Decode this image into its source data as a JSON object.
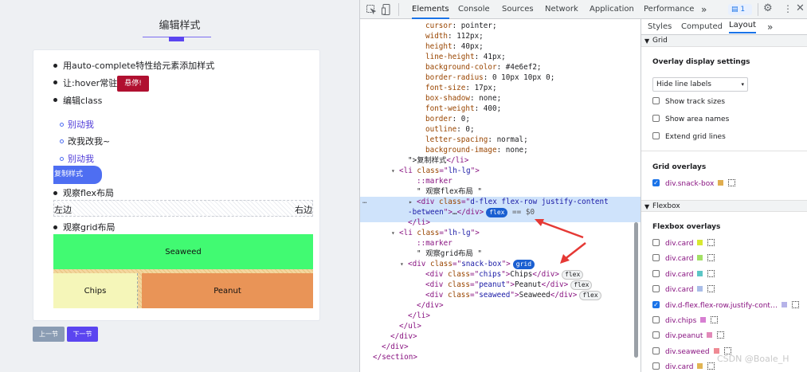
{
  "page": {
    "title": "编辑样式"
  },
  "list": [
    {
      "text": "用auto-complete特性给元素添加样式"
    },
    {
      "text": "让:hover常驻",
      "button": "悬停!"
    },
    {
      "text": "编辑class",
      "sub": [
        "别动我",
        "改我改我~",
        "别动我"
      ],
      "button": "复制样式"
    },
    {
      "text": "观察flex布局",
      "left": "左边",
      "right": "右边"
    },
    {
      "text": "观察grid布局",
      "cells": {
        "seaweed": "Seaweed",
        "chips": "Chips",
        "peanut": "Peanut"
      }
    }
  ],
  "pager": {
    "prev": "上一节",
    "next": "下一节"
  },
  "devtools": {
    "tabs": [
      "Elements",
      "Console",
      "Sources",
      "Network",
      "Application",
      "Performance"
    ],
    "more": "»",
    "issues": "1",
    "code": [
      {
        "i": 8,
        "p": [
          [
            "at",
            "cursor"
          ],
          [
            "tx",
            ": pointer;"
          ]
        ]
      },
      {
        "i": 8,
        "p": [
          [
            "at",
            "width"
          ],
          [
            "tx",
            ": 112px;"
          ]
        ]
      },
      {
        "i": 8,
        "p": [
          [
            "at",
            "height"
          ],
          [
            "tx",
            ": 40px;"
          ]
        ]
      },
      {
        "i": 8,
        "p": [
          [
            "at",
            "line-height"
          ],
          [
            "tx",
            ": 41px;"
          ]
        ]
      },
      {
        "i": 8,
        "p": [
          [
            "at",
            "background-color"
          ],
          [
            "tx",
            ": #4e6ef2;"
          ]
        ]
      },
      {
        "i": 8,
        "p": [
          [
            "at",
            "border-radius"
          ],
          [
            "tx",
            ": 0 10px 10px 0;"
          ]
        ]
      },
      {
        "i": 8,
        "p": [
          [
            "at",
            "font-size"
          ],
          [
            "tx",
            ": 17px;"
          ]
        ]
      },
      {
        "i": 8,
        "p": [
          [
            "at",
            "box-shadow"
          ],
          [
            "tx",
            ": none;"
          ]
        ]
      },
      {
        "i": 8,
        "p": [
          [
            "at",
            "font-weight"
          ],
          [
            "tx",
            ": 400;"
          ]
        ]
      },
      {
        "i": 8,
        "p": [
          [
            "at",
            "border"
          ],
          [
            "tx",
            ": 0;"
          ]
        ]
      },
      {
        "i": 8,
        "p": [
          [
            "at",
            "outline"
          ],
          [
            "tx",
            ": 0;"
          ]
        ]
      },
      {
        "i": 8,
        "p": [
          [
            "at",
            "letter-spacing"
          ],
          [
            "tx",
            ": normal;"
          ]
        ]
      },
      {
        "i": 8,
        "p": [
          [
            "at",
            "background-image"
          ],
          [
            "tx",
            ": none;"
          ]
        ]
      },
      {
        "i": 6,
        "p": [
          [
            "tx",
            "\">复制样式"
          ],
          [
            "tg",
            "</li>"
          ]
        ]
      },
      {
        "i": 5,
        "a": "▾",
        "p": [
          [
            "tg",
            "<li "
          ],
          [
            "at",
            "class"
          ],
          [
            "tg",
            "=\""
          ],
          [
            "av",
            "lh-lg"
          ],
          [
            "tg",
            "\">"
          ]
        ]
      },
      {
        "i": 7,
        "p": [
          [
            "tg",
            "::marker"
          ]
        ]
      },
      {
        "i": 7,
        "p": [
          [
            "tx",
            "\" 观察flex布局 \""
          ]
        ]
      },
      {
        "i": 7,
        "a": "▸",
        "p": [
          [
            "tg",
            "<div "
          ],
          [
            "at",
            "class"
          ],
          [
            "tg",
            "=\""
          ],
          [
            "av",
            "d-flex flex-row justify-content"
          ]
        ]
      },
      {
        "i": 6,
        "p": [
          [
            "av",
            "-between"
          ],
          [
            "tg",
            "\">"
          ],
          [
            "tx",
            "…"
          ],
          [
            "tg",
            "</div>"
          ],
          [
            "badge",
            "flex"
          ],
          [
            "gy",
            " == $0"
          ]
        ]
      },
      {
        "i": 6,
        "p": [
          [
            "tg",
            "</li>"
          ]
        ]
      },
      {
        "i": 5,
        "a": "▾",
        "p": [
          [
            "tg",
            "<li "
          ],
          [
            "at",
            "class"
          ],
          [
            "tg",
            "=\""
          ],
          [
            "av",
            "lh-lg"
          ],
          [
            "tg",
            "\">"
          ]
        ]
      },
      {
        "i": 7,
        "p": [
          [
            "tg",
            "::marker"
          ]
        ]
      },
      {
        "i": 7,
        "p": [
          [
            "tx",
            "\" 观察grid布局 \""
          ]
        ]
      },
      {
        "i": 6,
        "a": "▾",
        "p": [
          [
            "tg",
            "<div "
          ],
          [
            "at",
            "class"
          ],
          [
            "tg",
            "=\""
          ],
          [
            "av",
            "snack-box"
          ],
          [
            "tg",
            "\">"
          ],
          [
            "badge",
            "grid"
          ]
        ]
      },
      {
        "i": 8,
        "p": [
          [
            "tg",
            "<div "
          ],
          [
            "at",
            "class"
          ],
          [
            "tg",
            "=\""
          ],
          [
            "av",
            "chips"
          ],
          [
            "tg",
            "\">"
          ],
          [
            "tx",
            "Chips"
          ],
          [
            "tg",
            "</div>"
          ],
          [
            "badge2",
            "flex"
          ]
        ]
      },
      {
        "i": 8,
        "p": [
          [
            "tg",
            "<div "
          ],
          [
            "at",
            "class"
          ],
          [
            "tg",
            "=\""
          ],
          [
            "av",
            "peanut"
          ],
          [
            "tg",
            "\">"
          ],
          [
            "tx",
            "Peanut"
          ],
          [
            "tg",
            "</div>"
          ],
          [
            "badge2",
            "flex"
          ]
        ]
      },
      {
        "i": 8,
        "p": [
          [
            "tg",
            "<div "
          ],
          [
            "at",
            "class"
          ],
          [
            "tg",
            "=\""
          ],
          [
            "av",
            "seaweed"
          ],
          [
            "tg",
            "\">"
          ],
          [
            "tx",
            "Seaweed"
          ],
          [
            "tg",
            "</div>"
          ],
          [
            "badge2",
            "flex"
          ]
        ]
      },
      {
        "i": 7,
        "p": [
          [
            "tg",
            "</div>"
          ]
        ]
      },
      {
        "i": 6,
        "p": [
          [
            "tg",
            "</li>"
          ]
        ]
      },
      {
        "i": 5,
        "p": [
          [
            "tg",
            "</ul>"
          ]
        ]
      },
      {
        "i": 4,
        "p": [
          [
            "tg",
            "</div>"
          ]
        ]
      },
      {
        "i": 3,
        "p": [
          [
            "tg",
            "</div>"
          ]
        ]
      },
      {
        "i": 2,
        "p": [
          [
            "tg",
            "</section>"
          ]
        ]
      }
    ],
    "dots": "…",
    "right": {
      "tabs": [
        "Styles",
        "Computed",
        "Layout"
      ],
      "grid_header": "Grid",
      "overlay_settings": "Overlay display settings",
      "select": "Hide line labels",
      "options": [
        "Show track sizes",
        "Show area names",
        "Extend grid lines"
      ],
      "grid_overlays": "Grid overlays",
      "grid_items": [
        {
          "name": "div.snack-box",
          "checked": true,
          "color": "#e0ad4f"
        }
      ],
      "flexbox_header": "Flexbox",
      "flexbox_overlays": "Flexbox overlays",
      "flex_items": [
        {
          "name": "div.card",
          "checked": false,
          "color": "#d8e830"
        },
        {
          "name": "div.card",
          "checked": false,
          "color": "#a3e065"
        },
        {
          "name": "div.card",
          "checked": false,
          "color": "#5cc6c6"
        },
        {
          "name": "div.card",
          "checked": false,
          "color": "#a9bde8"
        },
        {
          "name": "div.d-flex.flex-row.justify-cont…",
          "checked": true,
          "color": "#b6b3e8"
        },
        {
          "name": "div.chips",
          "checked": false,
          "color": "#d77fd2"
        },
        {
          "name": "div.peanut",
          "checked": false,
          "color": "#e28ab9"
        },
        {
          "name": "div.seaweed",
          "checked": false,
          "color": "#ef8a93"
        },
        {
          "name": "div.card",
          "checked": false,
          "color": "#e1b453"
        }
      ]
    },
    "watermark": "CSDN @Boale_H"
  }
}
